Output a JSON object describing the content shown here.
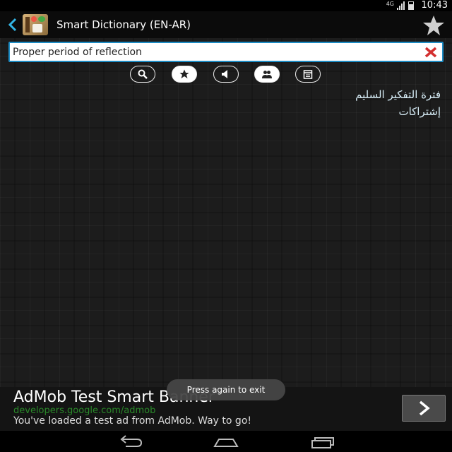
{
  "status_bar": {
    "time": "10:43",
    "network": "4G",
    "icons": [
      "signal-icon",
      "battery-icon"
    ]
  },
  "action_bar": {
    "title": "Smart Dictionary (EN-AR)",
    "icons": [
      "back-icon",
      "app-icon",
      "star-icon"
    ]
  },
  "search": {
    "value": "Proper period of reflection",
    "placeholder": "",
    "clear_icon": "close-icon"
  },
  "toolbar": {
    "buttons": [
      "search-icon",
      "star-icon",
      "speaker-icon",
      "people-icon",
      "calendar-icon"
    ]
  },
  "results": [
    "فترة التفكير السليم",
    "إشتراكات"
  ],
  "toast": {
    "text": "Press again to exit"
  },
  "ad": {
    "title": "AdMob Test Smart Banner",
    "url": "developers.google.com/admob",
    "message": "You've loaded a test ad from AdMob. Way to go!",
    "button_icon": "chevron-right-icon"
  },
  "nav_bar": {
    "icons": [
      "back-nav-icon",
      "home-nav-icon",
      "recents-nav-icon"
    ]
  },
  "colors": {
    "accent": "#1d8cc4",
    "clear": "#d32f2f",
    "result_text": "#d8eef8",
    "ad_url": "#2a8a2a"
  }
}
